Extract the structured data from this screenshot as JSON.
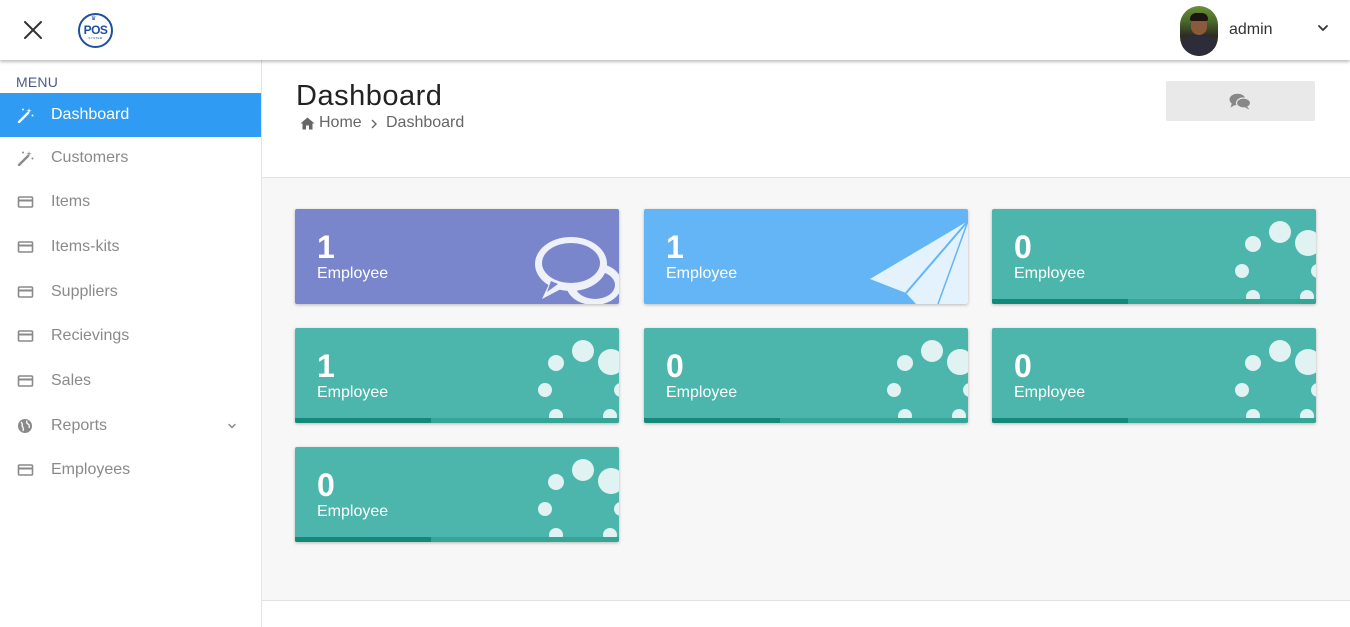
{
  "header": {
    "logo_text": "POS",
    "logo_sub": "SYSTEM",
    "username": "admin"
  },
  "sidebar": {
    "heading": "MENU",
    "items": [
      {
        "label": "Dashboard",
        "icon": "magic-wand-icon",
        "active": true
      },
      {
        "label": "Customers",
        "icon": "magic-wand-icon"
      },
      {
        "label": "Items",
        "icon": "card-icon"
      },
      {
        "label": "Items-kits",
        "icon": "card-icon"
      },
      {
        "label": "Suppliers",
        "icon": "card-icon"
      },
      {
        "label": "Recievings",
        "icon": "card-icon"
      },
      {
        "label": "Sales",
        "icon": "card-icon"
      },
      {
        "label": "Reports",
        "icon": "globe-icon",
        "has_submenu": true
      },
      {
        "label": "Employees",
        "icon": "card-icon"
      }
    ]
  },
  "page": {
    "title": "Dashboard",
    "breadcrumb": {
      "home": "Home",
      "current": "Dashboard"
    }
  },
  "cards": [
    {
      "count": "1",
      "label": "Employee",
      "color": "#7986cb",
      "art": "chat-bubbles-icon"
    },
    {
      "count": "1",
      "label": "Employee",
      "color": "#64b5f6",
      "art": "paper-plane-icon"
    },
    {
      "count": "0",
      "label": "Employee",
      "color": "#4db6ac",
      "art": "loading-dots-icon",
      "progress": 0.42
    },
    {
      "count": "1",
      "label": "Employee",
      "color": "#4db6ac",
      "art": "loading-dots-icon",
      "progress": 0.42
    },
    {
      "count": "0",
      "label": "Employee",
      "color": "#4db6ac",
      "art": "loading-dots-icon",
      "progress": 0.42
    },
    {
      "count": "0",
      "label": "Employee",
      "color": "#4db6ac",
      "art": "loading-dots-icon",
      "progress": 0.42
    },
    {
      "count": "0",
      "label": "Employee",
      "color": "#4db6ac",
      "art": "loading-dots-icon",
      "progress": 0.42
    }
  ],
  "colors": {
    "accent": "#2f9bf2",
    "progress_fill": "#14897a"
  }
}
